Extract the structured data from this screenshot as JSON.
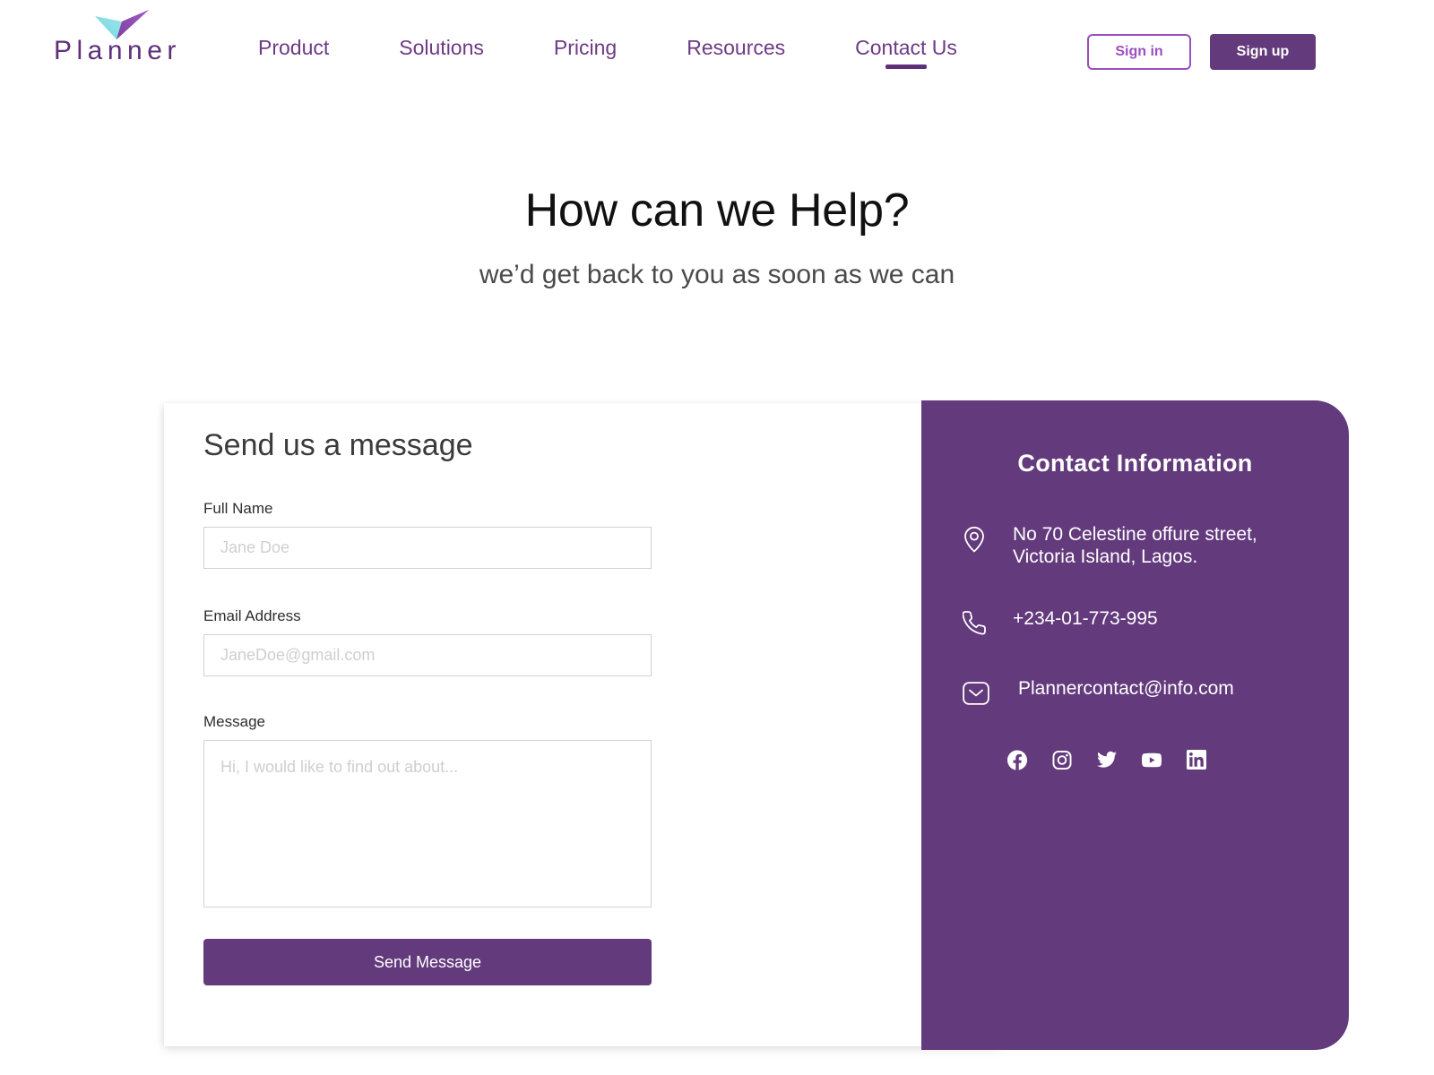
{
  "header": {
    "brand": {
      "word": "Planner",
      "mark_icon": "planner-check-logo"
    },
    "nav": [
      {
        "label": "Product",
        "active": false
      },
      {
        "label": "Solutions",
        "active": false
      },
      {
        "label": "Pricing",
        "active": false
      },
      {
        "label": "Resources",
        "active": false
      },
      {
        "label": "Contact Us",
        "active": true
      }
    ],
    "sign_in_label": "Sign in",
    "sign_up_label": "Sign up"
  },
  "hero": {
    "title": "How can we Help?",
    "subtitle": "we’d get back to you as soon as we can"
  },
  "form": {
    "title": "Send us a message",
    "full_name": {
      "label": "Full Name",
      "placeholder": "Jane Doe",
      "value": ""
    },
    "email": {
      "label": "Email Address",
      "placeholder": "JaneDoe@gmail.com",
      "value": ""
    },
    "message": {
      "label": "Message",
      "placeholder": "Hi, I would like to find out about...",
      "value": ""
    },
    "submit_label": "Send Message"
  },
  "contact_panel": {
    "title": "Contact Information",
    "address": {
      "icon": "map-pin-icon",
      "text": "No 70 Celestine offure street,\nVictoria Island, Lagos."
    },
    "phone": {
      "icon": "phone-icon",
      "text": "+234-01-773-995"
    },
    "email": {
      "icon": "envelope-icon",
      "text": "Plannercontact@info.com"
    },
    "socials": [
      {
        "name": "facebook-icon",
        "label": "Facebook"
      },
      {
        "name": "instagram-icon",
        "label": "Instagram"
      },
      {
        "name": "twitter-icon",
        "label": "Twitter"
      },
      {
        "name": "youtube-icon",
        "label": "YouTube"
      },
      {
        "name": "linkedin-icon",
        "label": "LinkedIn"
      }
    ]
  },
  "colors": {
    "brand_purple": "#633a7c",
    "nav_purple": "#6d3a86",
    "outline_purple": "#9b4fc0",
    "logo_teal": "#6fd8e0",
    "panel_bg": "#633a7c",
    "border_grey": "#d2d2d2",
    "placeholder_grey": "#cfcfcf"
  }
}
